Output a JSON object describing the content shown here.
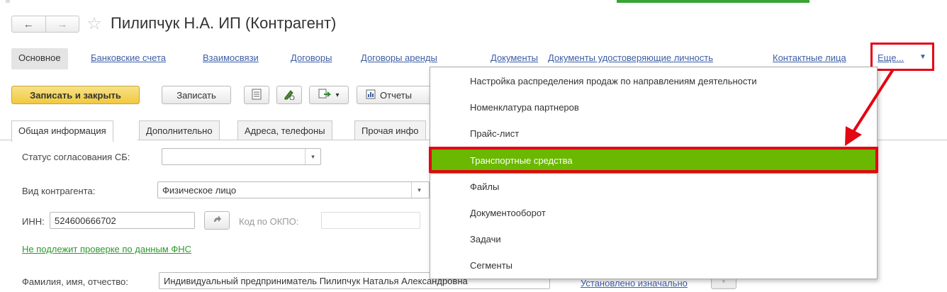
{
  "window": {
    "title": "Пилипчук Н.А. ИП (Контрагент)",
    "nav_back": "←",
    "nav_forward": "→",
    "favorite_glyph": "☆"
  },
  "linkbar": {
    "items": [
      "Основное",
      "Банковские счета",
      "Взаимосвязи",
      "Договоры",
      "Договоры аренды",
      "Документы",
      "Документы удостоверяющие личность",
      "Контактные лица"
    ],
    "more_label": "Еще...",
    "more_caret": "▼"
  },
  "toolbar": {
    "save_close": "Записать и закрыть",
    "save": "Записать",
    "reports": "Отчеты",
    "dropdown_caret": "▾",
    "icons": [
      "list-icon",
      "edit-icon",
      "create-based-icon",
      "report-icon"
    ]
  },
  "tabs": [
    "Общая информация",
    "Дополнительно",
    "Адреса, телефоны",
    "Прочая инфо"
  ],
  "form": {
    "status_label": "Статус согласования СБ:",
    "status_value": "",
    "kind_label": "Вид контрагента:",
    "kind_value": "Физическое лицо",
    "inn_label": "ИНН:",
    "inn_value": "524600666702",
    "okpo_label": "Код по ОКПО:",
    "okpo_value": "",
    "fns_link": "Не подлежит проверке по данным ФНС",
    "fio_label": "Фамилия, имя, отчество:",
    "fio_value": "Индивидуальный предприниматель Пилипчук Наталья Александровна",
    "fio_status_link": "Установлено изначально",
    "dropdown_caret": "▾"
  },
  "menu": {
    "items": [
      "Настройка распределения продаж по направлениям деятельности",
      "Номенклатура партнеров",
      "Прайс-лист",
      "Транспортные средства",
      "Файлы",
      "Документооборот",
      "Задачи",
      "Сегменты"
    ],
    "highlighted_index": 3
  },
  "colors": {
    "highlight_green": "#6bb800",
    "annotation_red": "#e30613",
    "link_blue": "#3c5ea6",
    "primary_button": "#f1c93c"
  }
}
